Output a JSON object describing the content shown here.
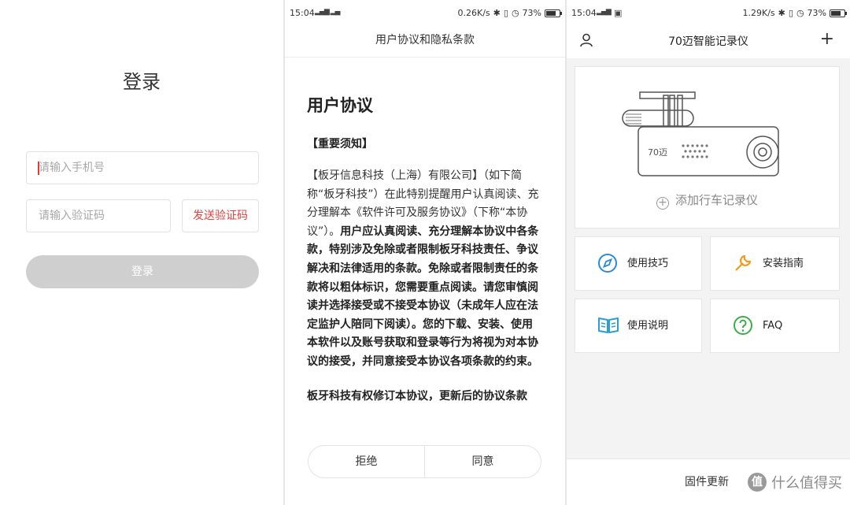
{
  "login": {
    "title": "登录",
    "phone_placeholder": "请输入手机号",
    "code_placeholder": "请输入验证码",
    "send_code": "发送验证码",
    "login_button": "登录"
  },
  "status_mid": {
    "time": "15:04",
    "speed": "0.26K/s",
    "battery": "73%"
  },
  "status_right": {
    "time": "15:04",
    "speed": "1.29K/s",
    "battery": "73%"
  },
  "agreement": {
    "nav_title": "用户协议和隐私条款",
    "heading": "用户协议",
    "notice": "【重要须知】",
    "para_intro": "【板牙信息科技（上海）有限公司】（如下简称“板牙科技”）在此特别提醒用户认真阅读、充分理解本《软件许可及服务协议》（下称“本协议”）。",
    "para_bold": "用户应认真阅读、充分理解本协议中各条款，特别涉及免除或者限制板牙科技责任、争议解决和法律适用的条款。免除或者限制责任的条款将以粗体标识，您需要重点阅读。请您审慎阅读并选择接受或不接受本协议（未成年人应在法定监护人陪同下阅读）。您的下载、安装、使用本软件以及账号获取和登录等行为将视为对本协议的接受，并同意接受本协议各项条款的约束。",
    "para_cut": "板牙科技有权修订本协议，更新后的协议条款",
    "reject": "拒绝",
    "agree": "同意"
  },
  "home": {
    "title": "70迈智能记录仪",
    "device_brand": "70迈",
    "add_device": "添加行车记录仪",
    "tiles": [
      {
        "label": "使用技巧",
        "icon": "compass-icon",
        "color": "#2a8bd6"
      },
      {
        "label": "安装指南",
        "icon": "wrench-icon",
        "color": "#f29a1f"
      },
      {
        "label": "使用说明",
        "icon": "book-icon",
        "color": "#2a9fd6"
      },
      {
        "label": "FAQ",
        "icon": "help-circle-icon",
        "color": "#3cad46"
      }
    ],
    "firmware": "固件更新",
    "watermark_badge": "值",
    "watermark_text": "什么值得买"
  }
}
